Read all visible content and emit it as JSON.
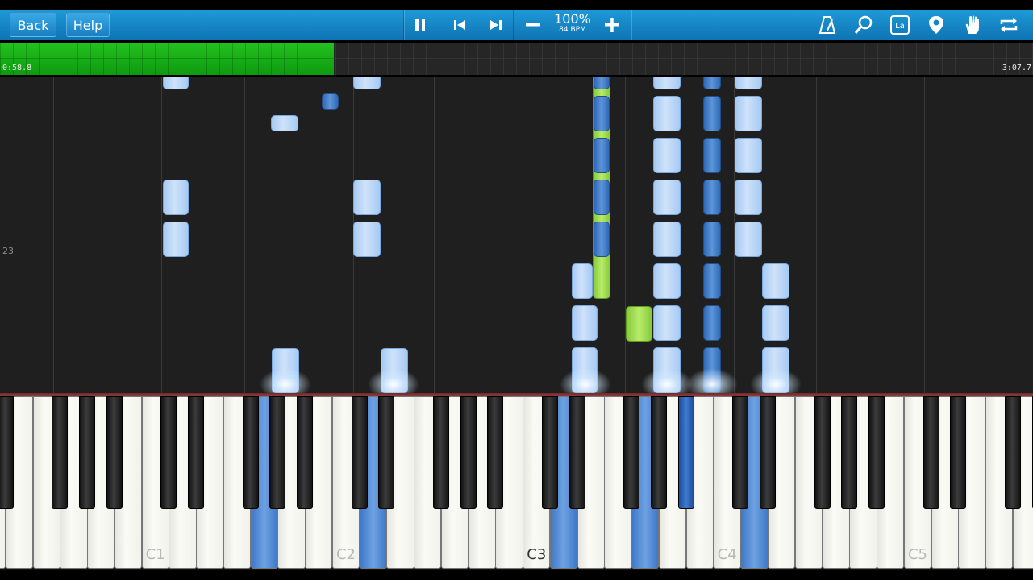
{
  "toolbar": {
    "back_label": "Back",
    "help_label": "Help",
    "tempo_percent": "100%",
    "tempo_bpm": "84 BPM",
    "icons": [
      "pause-icon",
      "skip-back-icon",
      "skip-forward-icon",
      "minus-icon",
      "plus-icon",
      "metronome-icon",
      "magnifier-icon",
      "note-label-icon",
      "location-pin-icon",
      "hand-icon",
      "loop-icon"
    ],
    "color_bar": "#1a8ccc"
  },
  "timeline": {
    "current_time": "0:58.8",
    "total_time": "3:07.7",
    "progress_fraction": 0.323,
    "progress_color": "#1fb01a"
  },
  "piano_roll": {
    "measure_number": "23",
    "note_colors": {
      "right_hand_light": "#b8d6f7",
      "right_hand_dark": "#3f7cc8",
      "left_hand": "#9ad94e"
    }
  },
  "keyboard": {
    "octave_labels": [
      "C1",
      "C2",
      "C3",
      "C4",
      "C5"
    ],
    "highlighted_label": "C3"
  }
}
